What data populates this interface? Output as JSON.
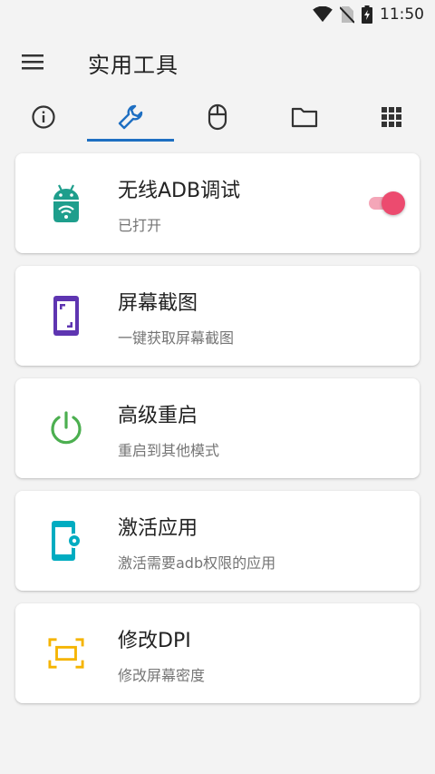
{
  "status": {
    "time": "11:50",
    "icons": [
      "wifi-icon",
      "no-sim-icon",
      "battery-charging-icon"
    ]
  },
  "appbar": {
    "title": "实用工具",
    "menu_icon": "menu-icon"
  },
  "tabs": [
    {
      "icon": "info-icon",
      "selected": false
    },
    {
      "icon": "wrench-icon",
      "selected": true
    },
    {
      "icon": "mouse-icon",
      "selected": false
    },
    {
      "icon": "folder-icon",
      "selected": false
    },
    {
      "icon": "apps-grid-icon",
      "selected": false
    }
  ],
  "cards": [
    {
      "title": "无线ADB调试",
      "subtitle": "已打开",
      "icon": "android-wifi-icon",
      "icon_color": "#1e9e8c",
      "toggle_on": true
    },
    {
      "title": "屏幕截图",
      "subtitle": "一键获取屏幕截图",
      "icon": "screenshot-icon",
      "icon_color": "#5e35b1"
    },
    {
      "title": "高级重启",
      "subtitle": "重启到其他模式",
      "icon": "power-icon",
      "icon_color": "#4caf50"
    },
    {
      "title": "激活应用",
      "subtitle": "激活需要adb权限的应用",
      "icon": "phone-settings-icon",
      "icon_color": "#00acc1"
    },
    {
      "title": "修改DPI",
      "subtitle": "修改屏幕密度",
      "icon": "dpi-frame-icon",
      "icon_color": "#f5b400"
    }
  ],
  "colors": {
    "accent": "#1e6fc2",
    "toggle_thumb": "#ec4b6f",
    "toggle_track": "#f4a6b8",
    "background": "#f3f3f3"
  }
}
